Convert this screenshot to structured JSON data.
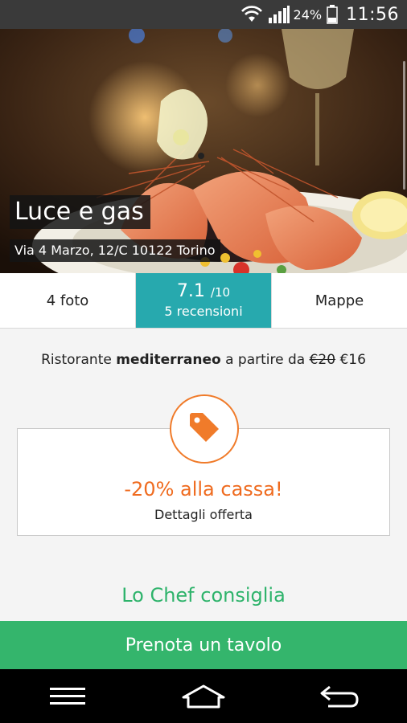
{
  "status_bar": {
    "battery_pct": "24%",
    "time": "11:56",
    "icons": [
      "wifi-icon",
      "signal-icon",
      "battery-icon"
    ]
  },
  "restaurant": {
    "name": "Luce e gas",
    "address": "Via 4 Marzo, 12/C 10122 Torino"
  },
  "tabs": {
    "photos": "4 foto",
    "rating": "7.1",
    "rating_max": "/10",
    "reviews": "5 recensioni",
    "maps": "Mappe"
  },
  "info": {
    "prefix": "Ristorante",
    "cuisine": "mediterraneo",
    "middle": "a partire da",
    "old_price": "€20",
    "new_price": "€16"
  },
  "offer": {
    "icon": "price-tag-icon",
    "title": "-20% alla cassa!",
    "details": "Dettagli offerta"
  },
  "chef_section": "Lo Chef consiglia",
  "book_button": "Prenota un tavolo",
  "nav": {
    "icons": [
      "menu-icon",
      "home-icon",
      "back-icon"
    ]
  },
  "colors": {
    "teal": "#27a9ae",
    "orange": "#ef6b1f",
    "green": "#34b56c",
    "chef_green": "#2eb36b"
  }
}
